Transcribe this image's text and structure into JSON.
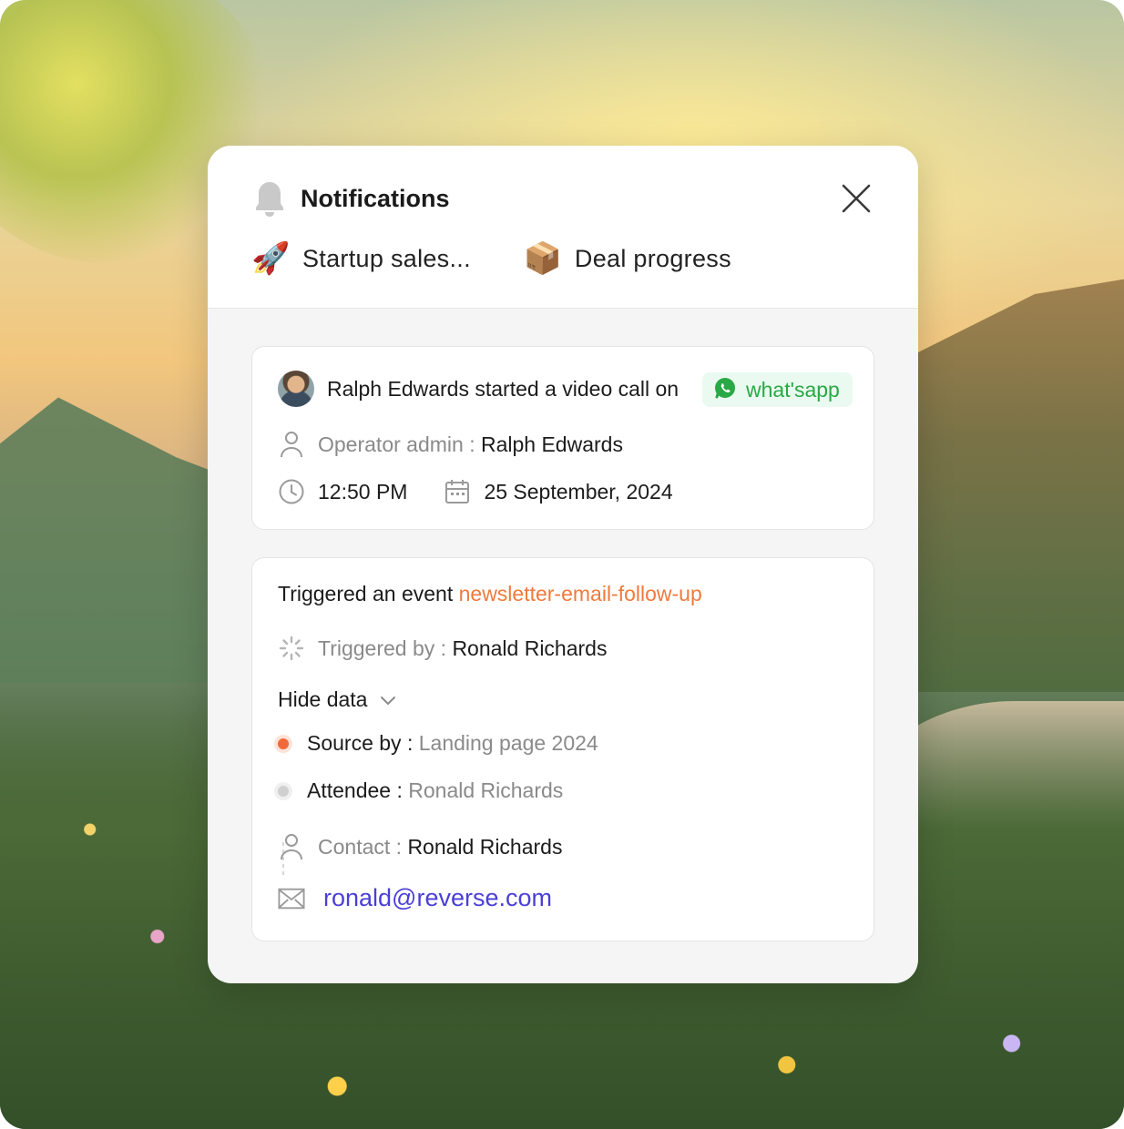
{
  "header": {
    "title": "Notifications",
    "tabs": [
      {
        "emoji": "🚀",
        "label": "Startup sales..."
      },
      {
        "emoji": "📦",
        "label": "Deal progress"
      }
    ]
  },
  "call_card": {
    "actor": "Ralph Edwards",
    "action": " started a video call on",
    "channel": "what'sapp",
    "operator_label": "Operator admin : ",
    "operator_value": "Ralph Edwards",
    "time": "12:50 PM",
    "date": "25 September, 2024"
  },
  "event_card": {
    "prefix": "Triggered an event ",
    "event_name": "newsletter-email-follow-up",
    "triggered_label": "Triggered by : ",
    "triggered_value": "Ronald Richards",
    "toggle_label": "Hide data",
    "source_label": "Source by : ",
    "source_value": "Landing page 2024",
    "attendee_label": "Attendee : ",
    "attendee_value": "Ronald Richards",
    "contact_label": "Contact : ",
    "contact_value": "Ronald Richards",
    "email": "ronald@reverse.com"
  },
  "colors": {
    "accent_orange": "#ef7a3c",
    "whatsapp_green": "#2aa845",
    "link_purple": "#4b3fd6"
  }
}
